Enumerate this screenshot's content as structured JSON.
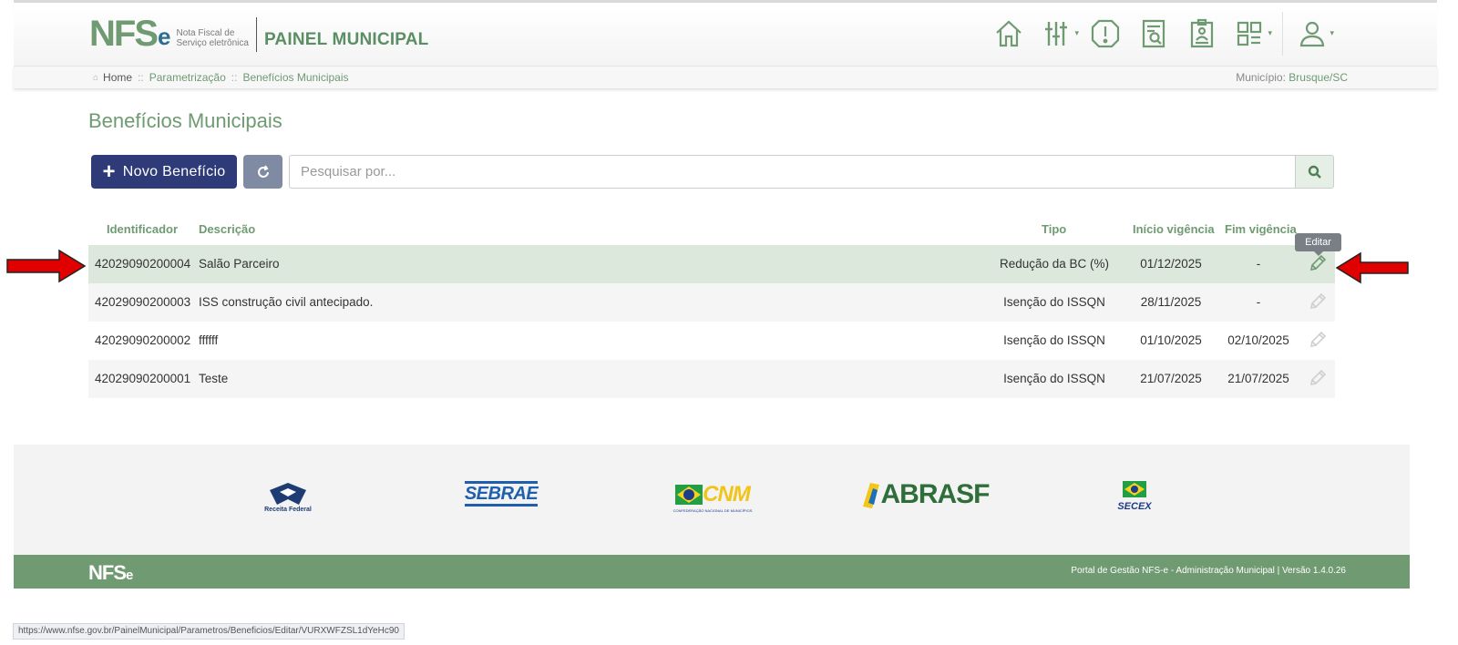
{
  "header": {
    "logo_main": "NFS",
    "logo_e": "e",
    "logo_sub_1": "Nota Fiscal de",
    "logo_sub_2": "Serviço eletrônica",
    "panel_title": "PAINEL MUNICIPAL",
    "nav_icons": [
      "home-icon",
      "settings-sliders-icon",
      "alert-icon",
      "report-search-icon",
      "clipboard-icon",
      "apps-grid-icon",
      "user-icon"
    ]
  },
  "breadcrumb": {
    "home": "Home",
    "sep": "::",
    "item1": "Parametrização",
    "item2": "Benefícios Municipais"
  },
  "municipio": {
    "label": "Município:",
    "value": "Brusque/SC"
  },
  "page": {
    "title": "Benefícios Municipais",
    "new_button_label": "Novo Benefício",
    "search_placeholder": "Pesquisar por..."
  },
  "table": {
    "headers": {
      "identificador": "Identificador",
      "descricao": "Descrição",
      "tipo": "Tipo",
      "inicio": "Início vigência",
      "fim": "Fim vigência"
    },
    "rows": [
      {
        "id": "42029090200004",
        "descricao": "Salão Parceiro",
        "tipo": "Redução da BC (%)",
        "inicio": "01/12/2025",
        "fim": "-"
      },
      {
        "id": "42029090200003",
        "descricao": "ISS construção civil antecipado.",
        "tipo": "Isenção do ISSQN",
        "inicio": "28/11/2025",
        "fim": "-"
      },
      {
        "id": "42029090200002",
        "descricao": "ffffff",
        "tipo": "Isenção do ISSQN",
        "inicio": "01/10/2025",
        "fim": "02/10/2025"
      },
      {
        "id": "42029090200001",
        "descricao": "Teste",
        "tipo": "Isenção do ISSQN",
        "inicio": "21/07/2025",
        "fim": "21/07/2025"
      }
    ],
    "edit_tooltip": "Editar"
  },
  "partners": {
    "receita": "Receita Federal",
    "sebrae": "SEBRAE",
    "cnm": "CNM",
    "cnm_sub": "CONFEDERAÇÃO NACIONAL DE MUNICÍPIOS",
    "abrasf": "ABRASF",
    "secex": "SECEX"
  },
  "footer": {
    "logo": "NFS",
    "logo_e": "e",
    "text": "Portal de Gestão NFS-e - Administração Municipal | Versão 1.4.0.26"
  },
  "status_url": "https://www.nfse.gov.br/PainelMunicipal/Parametros/Beneficios/Editar/VURXWFZSL1dYeHc90",
  "colors": {
    "brand_green": "#6f9a72",
    "primary_button": "#2e3b78",
    "annotation_arrow": "#e00000"
  }
}
